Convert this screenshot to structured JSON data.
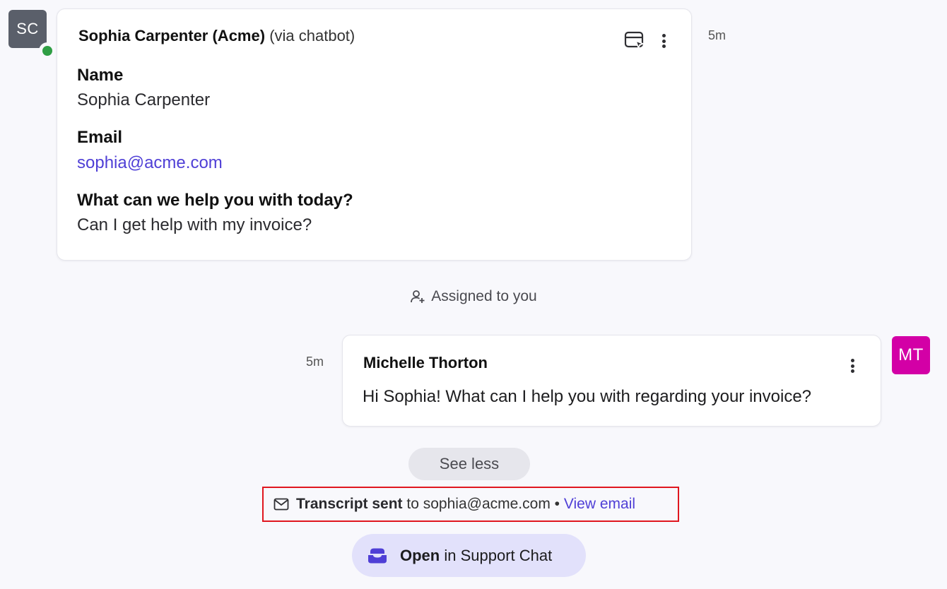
{
  "thread": {
    "customer_message": {
      "avatar_initials": "SC",
      "sender_name": "Sophia Carpenter (Acme)",
      "via": "(via chatbot)",
      "timestamp": "5m",
      "fields": [
        {
          "label": "Name",
          "value": "Sophia Carpenter"
        },
        {
          "label": "Email",
          "value": "sophia@acme.com"
        },
        {
          "label": "What can we help you with today?",
          "value": "Can I get help with my invoice?"
        }
      ]
    },
    "assignment_event": {
      "text": "Assigned to you",
      "icon": "user-plus-icon"
    },
    "agent_reply": {
      "avatar_initials": "MT",
      "sender_name": "Michelle Thorton",
      "body": "Hi Sophia! What can I help you with regarding your invoice?",
      "timestamp": "5m"
    },
    "see_less_label": "See less",
    "transcript": {
      "icon": "mail-icon",
      "bold": "Transcript sent",
      "text": "to sophia@acme.com",
      "separator": "•",
      "link": "View email"
    },
    "open_button": {
      "icon": "support-chat-icon",
      "bold": "Open",
      "text": "in Support Chat"
    }
  },
  "colors": {
    "background": "#f8f8fc",
    "link": "#4f3fd6",
    "presence_online": "#2f9e44",
    "agent_avatar": "#d300a6",
    "customer_avatar": "#5a5f6a",
    "highlight_border": "#e0161f",
    "open_button_bg": "#e2e1fb"
  }
}
